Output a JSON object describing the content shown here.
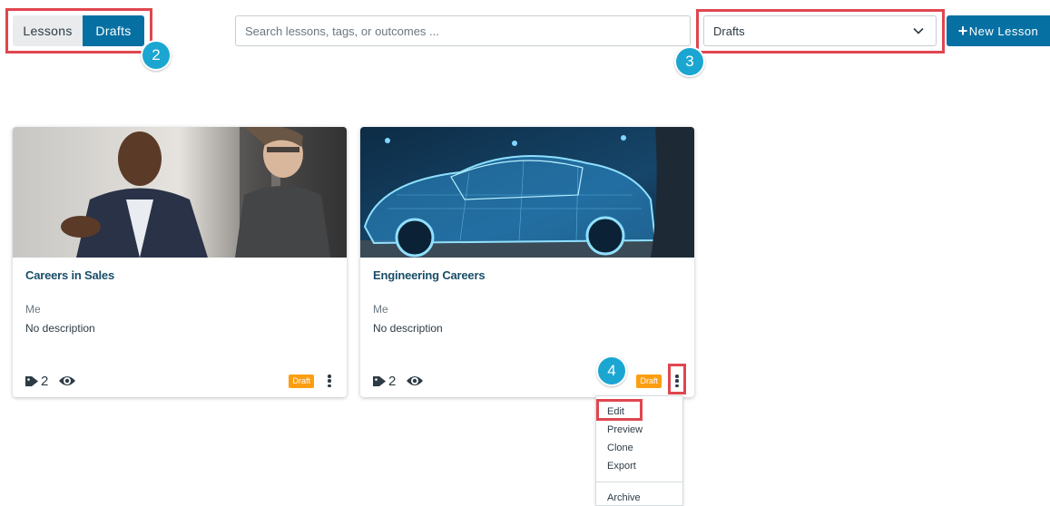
{
  "toggle": {
    "lessons_label": "Lessons",
    "drafts_label": "Drafts",
    "active": "Drafts"
  },
  "search": {
    "placeholder": "Search lessons, tags, or outcomes ...",
    "value": ""
  },
  "filter": {
    "selected": "Drafts",
    "icon": "chevron-down-icon"
  },
  "new_lesson": {
    "icon": "+",
    "label": "New Lesson"
  },
  "callouts": {
    "step2": "2",
    "step3": "3",
    "step4": "4"
  },
  "cards": [
    {
      "title": "Careers in Sales",
      "author": "Me",
      "description": "No description",
      "tag_count": "2",
      "status": "Draft"
    },
    {
      "title": "Engineering Careers",
      "author": "Me",
      "description": "No description",
      "tag_count": "2",
      "status": "Draft"
    }
  ],
  "menu": {
    "items": [
      "Edit",
      "Preview",
      "Clone",
      "Export",
      "Archive"
    ]
  },
  "colors": {
    "primary": "#0770a3",
    "draft_badge": "#fc9e12",
    "highlight": "#e0464f",
    "callout": "#1ba6d2",
    "title": "#194e68"
  }
}
